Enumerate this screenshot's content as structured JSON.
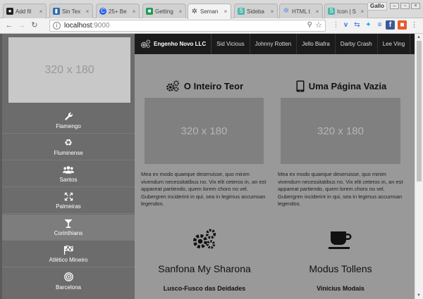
{
  "browser": {
    "tabs": [
      {
        "label": "Add fil",
        "favicon": "github-icon",
        "color": "#222222"
      },
      {
        "label": "Sin Tex",
        "favicon": "bookmark-icon",
        "color": "#2b6cb0"
      },
      {
        "label": "25+ Be",
        "favicon": "c-logo-icon",
        "color": "#2563eb"
      },
      {
        "label": "Getting",
        "favicon": "semantic-ui-icon",
        "color": "#1f9d55"
      },
      {
        "label": "Seman",
        "favicon": "semantic-gear-icon",
        "color": "#444444",
        "active": true
      },
      {
        "label": "Sideba",
        "favicon": "s-logo-icon",
        "color": "#4db6ac"
      },
      {
        "label": "HTML t",
        "favicon": "html-gear-icon",
        "color": "#5b8def"
      },
      {
        "label": "Icon | S",
        "favicon": "s-logo-icon",
        "color": "#4db6ac"
      }
    ],
    "profile": "Gallo",
    "url_host": "localhost",
    "url_port": ":9000"
  },
  "sidebar": {
    "image_placeholder": "320 x 180",
    "items": [
      {
        "label": "Flamengo",
        "icon": "wrench-icon"
      },
      {
        "label": "Fluminense",
        "icon": "recycle-icon"
      },
      {
        "label": "Santos",
        "icon": "users-icon"
      },
      {
        "label": "Palmeiras",
        "icon": "expand-icon"
      },
      {
        "label": "Corinthians",
        "icon": "cocktail-icon",
        "active": true
      },
      {
        "label": "Atlético Mineiro",
        "icon": "flag-checkered-icon"
      },
      {
        "label": "Barcelona",
        "icon": "bullseye-icon"
      }
    ]
  },
  "topnav": {
    "brand": "Engenho Novo LLC",
    "links": [
      "Sid Vicious",
      "Johnny Rotten",
      "Jello Biafra",
      "Darby Crash",
      "Lee Ving"
    ]
  },
  "cards": [
    {
      "title": "O Inteiro Teor",
      "icon": "gears-icon",
      "placeholder": "320 x 180",
      "text": "Mea ex modo quaeque deseruisse, quo minim vivendum necessitatibus no. Vix elit ceteros in, an est appareat partiendo, quem lorem choro no vel. Gubergren inciderint in qui, sea in legimus accumsan legendos."
    },
    {
      "title": "Uma Página Vazia",
      "icon": "tablet-icon",
      "placeholder": "320 x 180",
      "text": "Mea ex modo quaeque deseruisse, quo minim vivendum necessitatibus no. Vix elit ceteros in, an est appareat partiendo, quem lorem choro no vel. Gubergren inciderint in qui, sea in legimus accumsan legendos."
    }
  ],
  "features": [
    {
      "title": "Sanfona My Sharona",
      "subtitle": "Lusco-Fusco das Deidades",
      "icon": "gears-icon"
    },
    {
      "title": "Modus Tollens",
      "subtitle": "Vinicius Modais",
      "icon": "coffee-icon"
    }
  ]
}
